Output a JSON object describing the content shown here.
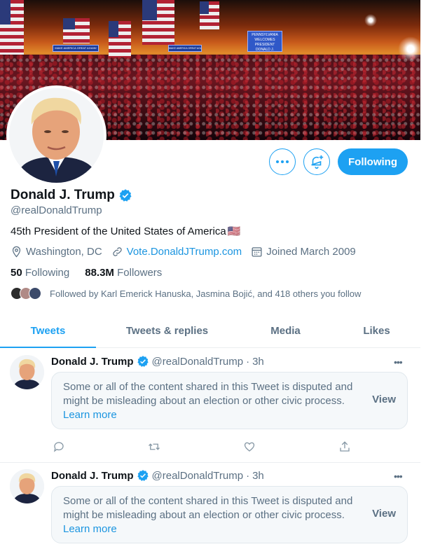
{
  "profile": {
    "name": "Donald J. Trump",
    "handle": "@realDonaldTrump",
    "bio": "45th President of the United States of America",
    "bio_emoji": "🇺🇸",
    "location": "Washington, DC",
    "website": "Vote.DonaldJTrump.com",
    "joined": "Joined March 2009",
    "following_count": "50",
    "following_label": "Following",
    "followers_count": "88.3M",
    "followers_label": "Followers",
    "followed_by": "Followed by Karl Emerick Hanuska, Jasmina Bojić, and 418 others you follow"
  },
  "banner_signs": {
    "sign1": "MAKE AMERICA GREAT AGAIN!",
    "sign2": "MAKE AMERICA GREAT AGAIN!",
    "sign3": "PENNSYLVANIA WELCOMES PRESIDENT DONALD J. TRUMP"
  },
  "buttons": {
    "more": "more-options",
    "notify": "notifications",
    "following": "Following"
  },
  "tabs": [
    {
      "label": "Tweets",
      "active": true
    },
    {
      "label": "Tweets & replies",
      "active": false
    },
    {
      "label": "Media",
      "active": false
    },
    {
      "label": "Likes",
      "active": false
    }
  ],
  "tweets": [
    {
      "name": "Donald J. Trump",
      "handle": "@realDonaldTrump",
      "separator": "·",
      "time": "3h",
      "notice": "Some or all of the content shared in this Tweet is disputed and might be misleading about an election or other civic process.",
      "learn_more": "Learn more",
      "view": "View"
    },
    {
      "name": "Donald J. Trump",
      "handle": "@realDonaldTrump",
      "separator": "·",
      "time": "3h",
      "notice": "Some or all of the content shared in this Tweet is disputed and might be misleading about an election or other civic process.",
      "learn_more": "Learn more",
      "view": "View"
    }
  ],
  "colors": {
    "accent": "#1da1f2",
    "link": "#1b95e0",
    "muted": "#5b7083",
    "text": "#0f1419"
  }
}
